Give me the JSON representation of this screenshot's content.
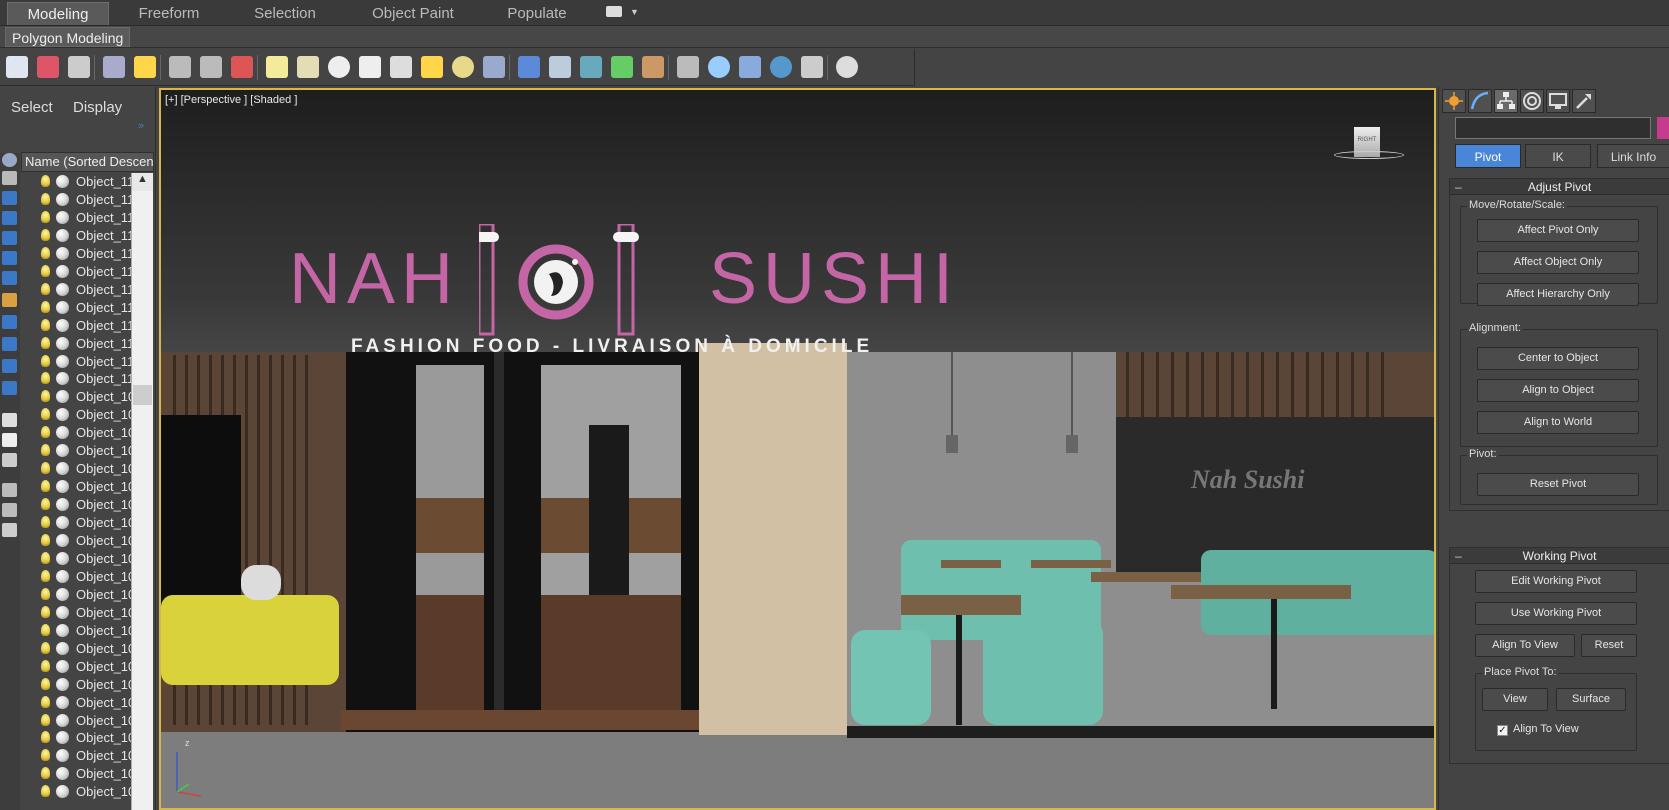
{
  "ribbon": {
    "tabs": [
      "Modeling",
      "Freeform",
      "Selection",
      "Object Paint",
      "Populate"
    ],
    "active_tab": "Modeling",
    "panel_label": "Polygon Modeling"
  },
  "toolbar": {
    "icons": [
      "teapot-icon",
      "render-frame-icon",
      "render-setup-icon",
      "render-table-icon",
      "light-bulb-icon",
      "camera-icon",
      "helper-icon",
      "camera-film-icon",
      "plane-icon",
      "dome-icon",
      "sphere-icon",
      "teapot-wire-icon",
      "cone-icon",
      "sun-icon",
      "disc-icon",
      "particles-icon",
      "molecule-icon",
      "lasso-icon",
      "gear-icon",
      "plant-icon",
      "hair-icon",
      "shell-icon",
      "globe-icon",
      "material-icon",
      "render-sphere-icon",
      "clipboard-icon",
      "help-icon"
    ]
  },
  "explorer": {
    "tabs": [
      "Select",
      "Display"
    ],
    "column_header": "Name (Sorted Descending)",
    "objects": [
      "Object_11",
      "Object_11",
      "Object_11",
      "Object_11",
      "Object_11",
      "Object_11",
      "Object_11",
      "Object_11",
      "Object_11",
      "Object_11",
      "Object_11",
      "Object_11",
      "Object_10",
      "Object_10",
      "Object_10",
      "Object_10",
      "Object_10",
      "Object_10",
      "Object_10",
      "Object_10",
      "Object_10",
      "Object_10",
      "Object_10",
      "Object_10",
      "Object_10",
      "Object_10",
      "Object_10",
      "Object_10",
      "Object_10",
      "Object_10",
      "Object_10",
      "Object_10",
      "Object_10",
      "Object_10",
      "Object_10"
    ]
  },
  "viewport": {
    "label": "[+] [Perspective ] [Shaded ]",
    "viewcube_face": "RIGHT",
    "sign": {
      "left_word": "NAH",
      "right_word": "SUSHI",
      "subtitle": "FASHION FOOD - LIVRAISON À DOMICILE"
    },
    "wall_text": "Nah Sushi",
    "axis_label": "z"
  },
  "command_panel": {
    "tabs": [
      "create-tab",
      "modify-tab",
      "hierarchy-tab",
      "motion-tab",
      "display-tab",
      "utilities-tab"
    ],
    "active_tab": "hierarchy-tab",
    "color": "#c73b8e",
    "subtabs": [
      "Pivot",
      "IK",
      "Link Info"
    ],
    "active_subtab": "Pivot",
    "adjust_pivot": {
      "title": "Adjust Pivot",
      "move_group": "Move/Rotate/Scale:",
      "affect_pivot": "Affect Pivot Only",
      "affect_object": "Affect Object Only",
      "affect_hierarchy": "Affect Hierarchy Only",
      "alignment_group": "Alignment:",
      "center_to_object": "Center to Object",
      "align_to_object": "Align to Object",
      "align_to_world": "Align to World",
      "pivot_group": "Pivot:",
      "reset_pivot": "Reset Pivot"
    },
    "working_pivot": {
      "title": "Working Pivot",
      "edit": "Edit Working Pivot",
      "use": "Use Working Pivot",
      "align_to_view": "Align To View",
      "reset": "Reset",
      "place_group": "Place Pivot To:",
      "view": "View",
      "surface": "Surface",
      "align_checkbox": "Align To View",
      "align_checked": true
    }
  }
}
